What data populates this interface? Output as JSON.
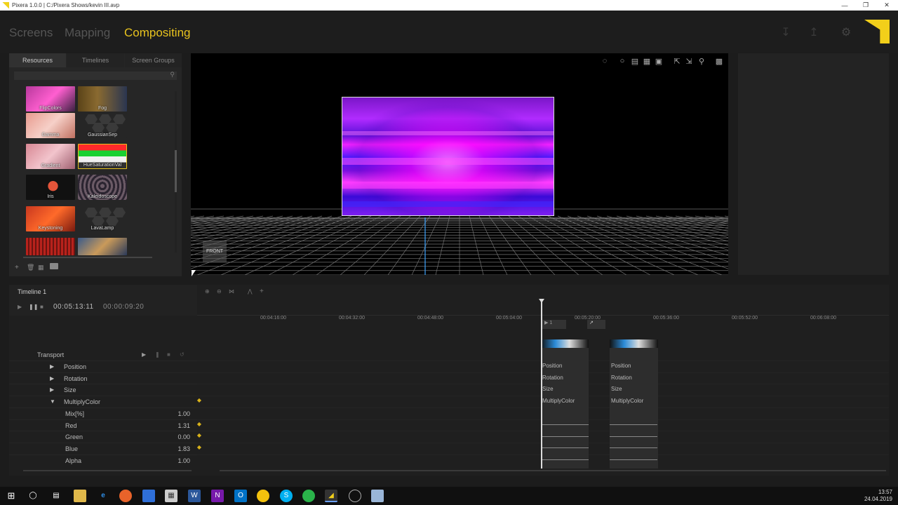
{
  "window": {
    "title": "Pixera 1.0.0 | C:/Pixera Shows/kevin III.avp"
  },
  "nav": {
    "tabs": [
      {
        "label": "Screens",
        "active": false
      },
      {
        "label": "Mapping",
        "active": false
      },
      {
        "label": "Compositing",
        "active": true
      }
    ]
  },
  "header_icons": [
    "download-icon",
    "upload-icon",
    "gear-icon"
  ],
  "colors": {
    "accent": "#e8c31e",
    "background": "#1c1c1c",
    "panel": "#262626",
    "keyframe": "#d9b21a"
  },
  "left_panel": {
    "tabs": [
      "Resources",
      "Timelines",
      "Screen Groups"
    ],
    "active_tab": "Resources",
    "resources": [
      "FlipColors",
      "Fog",
      "Gamma",
      "GaussianSep",
      "Gradient",
      "HueSaturationVal",
      "Iris",
      "Kaleidoscope",
      "Keystoning",
      "LavaLamp"
    ],
    "selected": "HueSaturationVal",
    "footer_icons": [
      "add-icon",
      "trash-icon",
      "grid-icon",
      "folder-icon"
    ]
  },
  "viewport": {
    "view_label": "FRONT"
  },
  "timeline": {
    "name": "Timeline 1",
    "current_time": "00:05:13:11",
    "duration": "00:00:09:20",
    "ruler": [
      "00:04:16:00",
      "00:04:32:00",
      "00:04:48:00",
      "00:05:04:00",
      "00:05:20:00",
      "00:05:36:00",
      "00:05:52:00",
      "00:06:08:00"
    ],
    "cue_label": "1",
    "transport_label": "Transport",
    "properties": [
      {
        "name": "Position",
        "value": "",
        "expanded": false,
        "indent": 0,
        "keyframe": false
      },
      {
        "name": "Rotation",
        "value": "",
        "expanded": false,
        "indent": 0,
        "keyframe": false
      },
      {
        "name": "Size",
        "value": "",
        "expanded": false,
        "indent": 0,
        "keyframe": false
      },
      {
        "name": "MultiplyColor",
        "value": "",
        "expanded": true,
        "indent": 0,
        "keyframe": true
      },
      {
        "name": "Mix[%]",
        "value": "1.00",
        "indent": 1,
        "keyframe": false
      },
      {
        "name": "Red",
        "value": "1.31",
        "indent": 1,
        "keyframe": true
      },
      {
        "name": "Green",
        "value": "0.00",
        "indent": 1,
        "keyframe": true
      },
      {
        "name": "Blue",
        "value": "1.83",
        "indent": 1,
        "keyframe": true
      },
      {
        "name": "Alpha",
        "value": "1.00",
        "indent": 1,
        "keyframe": false
      }
    ],
    "clip_labels": [
      "Position",
      "Rotation",
      "Size",
      "MultiplyColor"
    ]
  },
  "taskbar": {
    "time": "13:57",
    "date": "24.04.2019"
  }
}
